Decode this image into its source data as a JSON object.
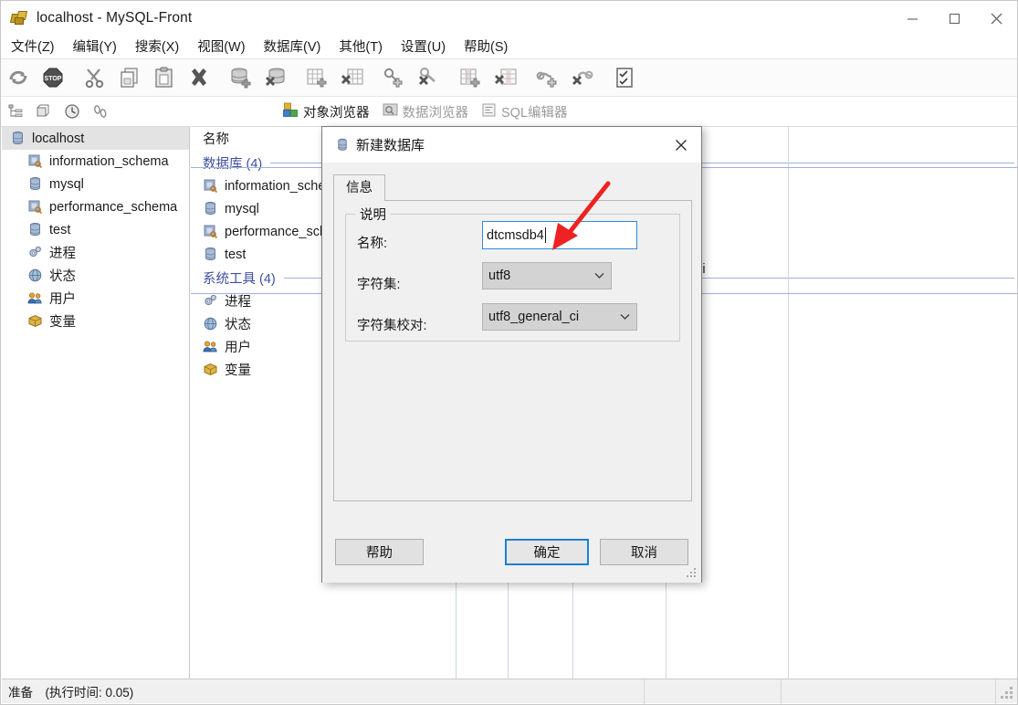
{
  "window": {
    "title": "localhost - MySQL-Front",
    "icon": "mysql-front-app-icon",
    "minimize_label": "—",
    "maximize_label": "☐",
    "close_label": "✕"
  },
  "menubar": {
    "items": [
      {
        "label": "文件(Z)",
        "name": "menu-file"
      },
      {
        "label": "编辑(Y)",
        "name": "menu-edit"
      },
      {
        "label": "搜索(X)",
        "name": "menu-search"
      },
      {
        "label": "视图(W)",
        "name": "menu-view"
      },
      {
        "label": "数据库(V)",
        "name": "menu-database"
      },
      {
        "label": "其他(T)",
        "name": "menu-other"
      },
      {
        "label": "设置(U)",
        "name": "menu-settings"
      },
      {
        "label": "帮助(S)",
        "name": "menu-help"
      }
    ]
  },
  "toolbar": {
    "buttons": [
      {
        "name": "refresh-icon",
        "tip": "刷新"
      },
      {
        "name": "stop-icon",
        "tip": "停止"
      },
      {
        "name": "cut-icon",
        "tip": "剪切"
      },
      {
        "name": "copy-icon",
        "tip": "复制"
      },
      {
        "name": "paste-icon",
        "tip": "粘贴"
      },
      {
        "name": "delete-icon",
        "tip": "删除"
      },
      {
        "name": "add-database-icon",
        "tip": "新建数据库"
      },
      {
        "name": "drop-database-icon",
        "tip": "删除数据库"
      },
      {
        "name": "add-table-icon",
        "tip": "新建表"
      },
      {
        "name": "drop-table-icon",
        "tip": "删除表"
      },
      {
        "name": "add-index-icon",
        "tip": "新建索引"
      },
      {
        "name": "drop-index-icon",
        "tip": "删除索引"
      },
      {
        "name": "add-field-icon",
        "tip": "新建字段"
      },
      {
        "name": "drop-field-icon",
        "tip": "删除字段"
      },
      {
        "name": "add-foreignkey-icon",
        "tip": "新建外键"
      },
      {
        "name": "drop-foreignkey-icon",
        "tip": "删除外键"
      },
      {
        "name": "checklist-icon",
        "tip": "任务"
      }
    ]
  },
  "toolbar2": {
    "small_buttons": [
      {
        "name": "tree-view-icon"
      },
      {
        "name": "objects-icon"
      },
      {
        "name": "history-icon"
      },
      {
        "name": "footprints-icon"
      }
    ],
    "view_tabs": [
      {
        "label": "对象浏览器",
        "name": "tab-object-browser",
        "icon": "object-browser-icon",
        "active": true
      },
      {
        "label": "数据浏览器",
        "name": "tab-data-browser",
        "icon": "data-browser-icon",
        "active": false
      },
      {
        "label": "SQL编辑器",
        "name": "tab-sql-editor",
        "icon": "sql-editor-icon",
        "active": false
      }
    ]
  },
  "tree": {
    "root": {
      "label": "localhost",
      "icon": "server-icon"
    },
    "children": [
      {
        "label": "information_schema",
        "icon": "schema-search-icon"
      },
      {
        "label": "mysql",
        "icon": "database-icon"
      },
      {
        "label": "performance_schema",
        "icon": "schema-search-icon"
      },
      {
        "label": "test",
        "icon": "database-icon"
      },
      {
        "label": "进程",
        "icon": "process-gear-icon"
      },
      {
        "label": "状态",
        "icon": "status-globe-icon"
      },
      {
        "label": "用户",
        "icon": "users-icon"
      },
      {
        "label": "变量",
        "icon": "variables-box-icon"
      }
    ]
  },
  "list": {
    "column_header": "名称",
    "groups": [
      {
        "title": "数据库 (4)",
        "name": "group-databases",
        "items": [
          {
            "label": "information_schema",
            "icon": "schema-search-icon"
          },
          {
            "label": "mysql",
            "icon": "database-icon"
          },
          {
            "label": "performance_schema",
            "icon": "schema-search-icon"
          },
          {
            "label": "test",
            "icon": "database-icon"
          }
        ]
      },
      {
        "title": "系统工具 (4)",
        "name": "group-system-tools",
        "items": [
          {
            "label": "进程",
            "icon": "process-gear-icon"
          },
          {
            "label": "状态",
            "icon": "status-globe-icon"
          },
          {
            "label": "用户",
            "icon": "users-icon"
          },
          {
            "label": "变量",
            "icon": "variables-box-icon"
          }
        ]
      }
    ],
    "partial_cell_value": "n_ci"
  },
  "dialog": {
    "title": "新建数据库",
    "icon": "database-icon",
    "close_label": "✕",
    "tab": "信息",
    "groupbox_legend": "说明",
    "fields": {
      "name_label": "名称:",
      "name_value": "dtcmsdb4",
      "charset_label": "字符集:",
      "charset_value": "utf8",
      "collation_label": "字符集校对:",
      "collation_value": "utf8_general_ci",
      "chevron": "⌄"
    },
    "buttons": {
      "help": "帮助",
      "ok": "确定",
      "cancel": "取消"
    }
  },
  "annotation": {
    "arrow_color": "#ee2222",
    "arrow_name": "red-pointer-arrow"
  },
  "statusbar": {
    "cells": [
      {
        "text": "准备　(执行时间: 0.05)",
        "name": "status-ready"
      },
      {
        "text": "",
        "name": "status-cell-2"
      },
      {
        "text": "",
        "name": "status-cell-3"
      },
      {
        "text": "",
        "name": "status-cell-4"
      }
    ]
  }
}
